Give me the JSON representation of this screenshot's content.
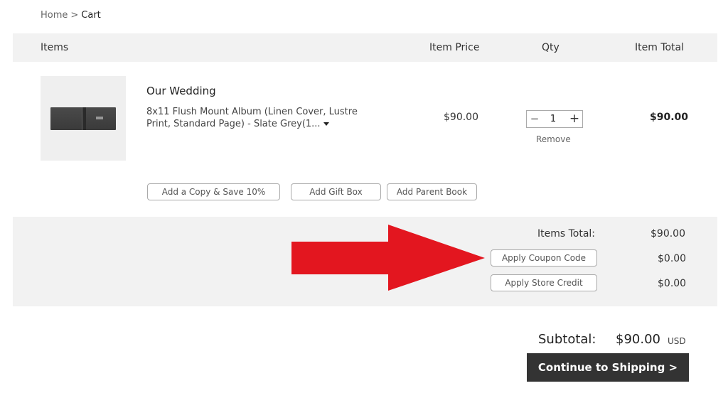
{
  "breadcrumb": {
    "home": "Home",
    "separator": ">",
    "current": "Cart"
  },
  "table_header": {
    "items": "Items",
    "item_price": "Item Price",
    "qty": "Qty",
    "item_total": "Item Total"
  },
  "line_item": {
    "name": "Our Wedding",
    "description": "8x11 Flush Mount Album (Linen Cover, Lustre Print, Standard Page) - Slate Grey(1...",
    "price": "$90.00",
    "qty": "1",
    "qty_minus": "−",
    "qty_plus": "+",
    "remove": "Remove",
    "total": "$90.00",
    "thumbnail_icon": "album-thumbnail"
  },
  "addons": {
    "copy": "Add a Copy & Save 10%",
    "gift_box": "Add Gift Box",
    "parent_book": "Add Parent Book"
  },
  "totals": {
    "items_total_label": "Items Total:",
    "items_total_value": "$90.00",
    "coupon_button": "Apply Coupon Code",
    "coupon_value": "$0.00",
    "store_credit_button": "Apply Store Credit",
    "store_credit_value": "$0.00"
  },
  "subtotal": {
    "label": "Subtotal:",
    "value": "$90.00",
    "currency": "USD"
  },
  "cta": {
    "label": "Continue to Shipping >"
  },
  "colors": {
    "annotation_arrow": "#e3161f",
    "cta_bg": "#333333",
    "panel_bg": "#f2f2f2"
  }
}
